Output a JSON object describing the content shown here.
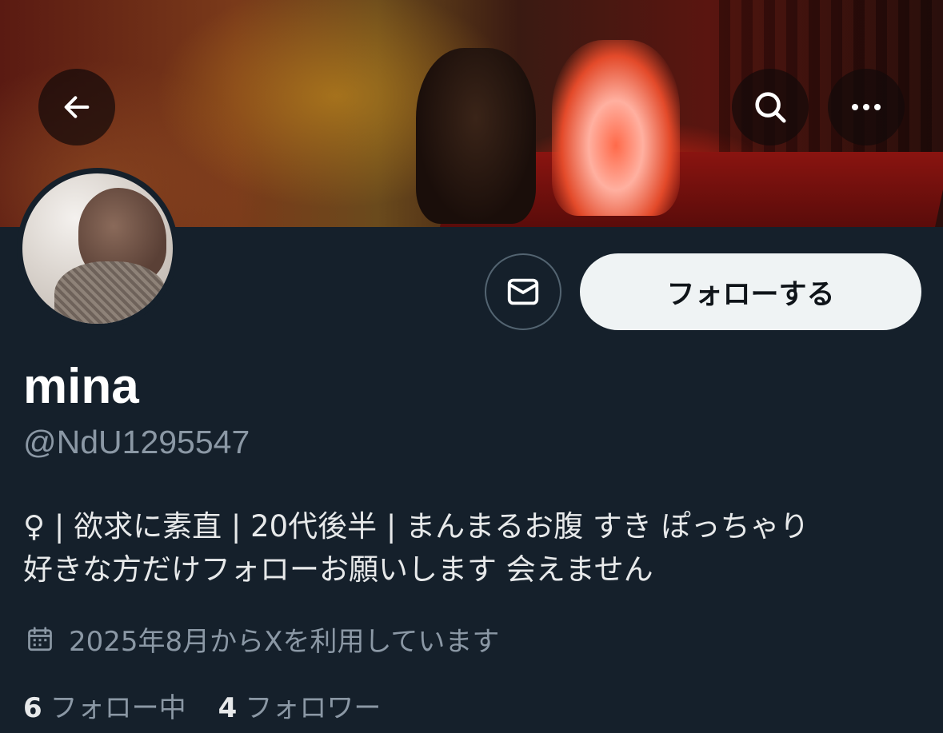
{
  "header": {
    "back_icon": "arrow-left-icon",
    "search_icon": "search-icon",
    "more_icon": "more-horizontal-icon"
  },
  "profile": {
    "display_name": "mina",
    "handle": "@NdU1295547",
    "bio_line1": "♀ | 欲求に素直 | 20代後半 | まんまるお腹 すき ぽっちゃり",
    "bio_line2": "好きな方だけフォローお願いします 会えません",
    "joined": "2025年8月からXを利用しています",
    "following_count": "6",
    "following_label": "フォロー中",
    "followers_count": "4",
    "followers_label": "フォロワー"
  },
  "actions": {
    "message_icon": "envelope-icon",
    "follow_label": "フォローする"
  },
  "colors": {
    "background": "#15202b",
    "secondary_text": "#8b98a5",
    "follow_button_bg": "#eff3f4",
    "follow_button_text": "#0f1419"
  }
}
